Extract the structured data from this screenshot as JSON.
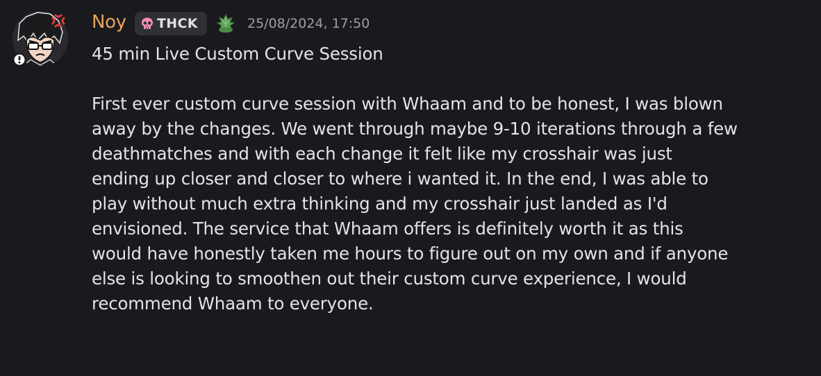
{
  "message": {
    "author": "Noy",
    "tag": "THCK",
    "timestamp": "25/08/2024, 17:50",
    "title": "45 min Live Custom Curve Session",
    "body_lines": [
      "First ever custom curve session with Whaam and to be honest, I was blown",
      "away by the changes. We went through maybe 9-10 iterations through a few",
      "deathmatches and with each change it felt like my crosshair was just",
      "ending up closer and closer to where i wanted it. In the end, I was able to",
      "play without much extra thinking and my crosshair just landed as I'd",
      "envisioned. The service that Whaam offers is definitely worth it as this",
      "would have honestly taken me hours to figure out on my own and if anyone",
      "else is looking to smoothen out their custom curve experience, I would",
      "recommend Whaam to everyone."
    ],
    "icons": {
      "avatar": "anime-avatar-icon",
      "tag": "skull-icon",
      "role": "plant-icon"
    },
    "colors": {
      "background": "#1a1a1e",
      "author": "#e9a35b",
      "tag_icon": "#f48fb1",
      "role_icon": "#5fa35a",
      "timestamp": "#9b9fa6",
      "text": "#e2e4e7"
    }
  }
}
